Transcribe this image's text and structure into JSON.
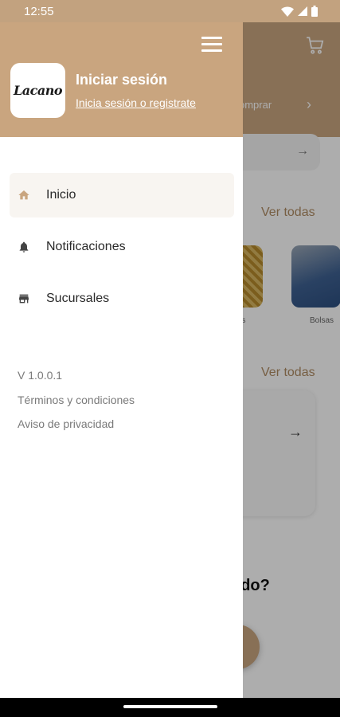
{
  "status_bar": {
    "time": "12:55"
  },
  "drawer": {
    "logo_text": "Lacano",
    "login_title": "Iniciar sesión",
    "login_link": "Inicia sesión o registrate",
    "menu": [
      {
        "label": "Inicio",
        "icon": "home-icon",
        "active": true
      },
      {
        "label": "Notificaciones",
        "icon": "bell-icon",
        "active": false
      },
      {
        "label": "Sucursales",
        "icon": "store-icon",
        "active": false
      }
    ],
    "version": "V 1.0.0.1",
    "terms": "Términos y condiciones",
    "privacy": "Aviso de privacidad"
  },
  "background": {
    "comprar_fragment": "omprar",
    "ver_todas_1": "Ver todas",
    "ver_todas_2": "Ver todas",
    "caption_a": "as",
    "caption_b": "Bolsas",
    "question_fragment": "udo?"
  },
  "colors": {
    "brand": "#c9a57f",
    "active_bg": "#f8f5f1",
    "accent_text": "#b08c64"
  }
}
